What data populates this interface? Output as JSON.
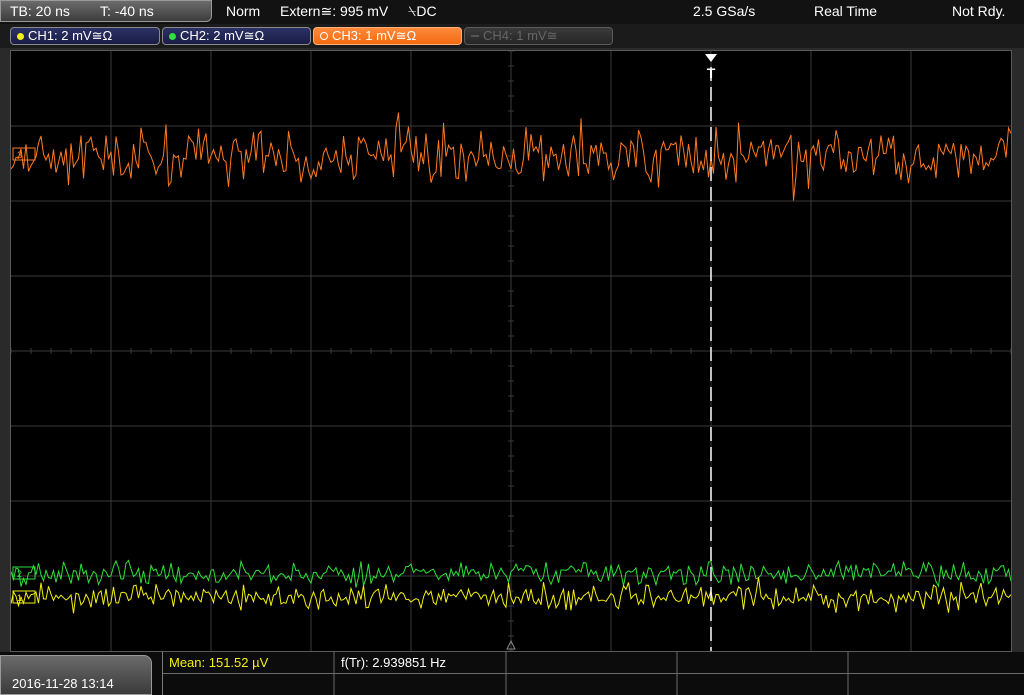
{
  "status_bar": {
    "timebase": "TB: 20 ns",
    "trigger_offset": "T: -40 ns",
    "trigger_mode": "Norm",
    "trigger_source": "Extern≅: 995 mV",
    "trigger_slope_coupling": "⍀DC",
    "sample_rate": "2.5 GSa/s",
    "acquisition_mode": "Real Time",
    "acq_status": "Not Rdy."
  },
  "channels": [
    {
      "label": "CH1: 2 mV≅Ω",
      "color": "#f5f010",
      "state": "enabled"
    },
    {
      "label": "CH2: 2 mV≅Ω",
      "color": "#2ee03a",
      "state": "enabled"
    },
    {
      "label": "CH3: 1 mV≅Ω",
      "color": "#ff7a22",
      "state": "active"
    },
    {
      "label": "CH4: 1 mV≅",
      "color": "#555555",
      "state": "disabled"
    }
  ],
  "waveform_markers": {
    "trigger_marker": "T"
  },
  "measurements": {
    "mean": "Mean: 151.52 µV",
    "frequency": "f(Tr): 2.939851 Hz"
  },
  "datetime": "2016-11-28 13:14",
  "colors": {
    "ch1": "#f5f010",
    "ch2": "#2ee03a",
    "ch3": "#ff7a22",
    "grid": "#3a3a3a",
    "measure_label": "#f5f010"
  }
}
